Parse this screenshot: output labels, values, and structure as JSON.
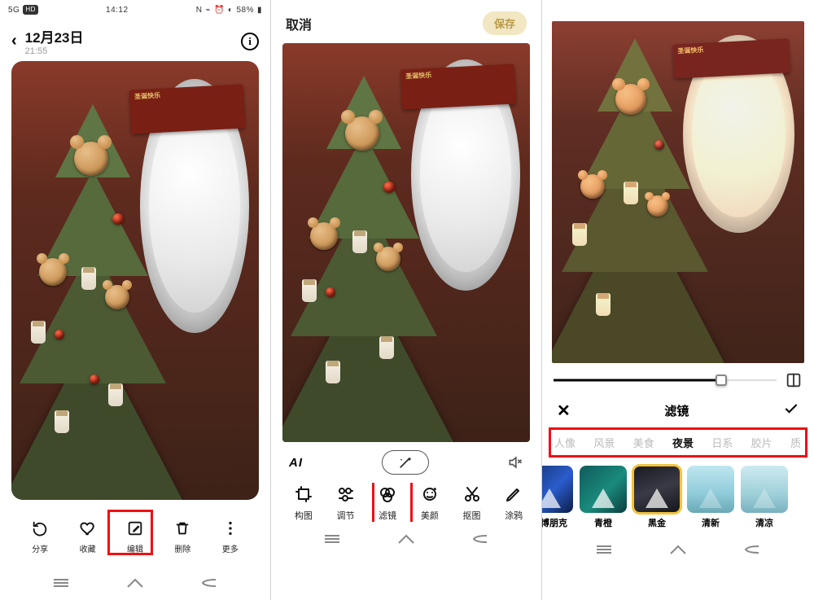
{
  "status": {
    "signal": "5G",
    "hd": "HD",
    "time": "14:12",
    "battery_pct": "58%"
  },
  "pane1": {
    "date": "12月23日",
    "time": "21:55",
    "toolbar": [
      {
        "key": "share",
        "label": "分享"
      },
      {
        "key": "fav",
        "label": "收藏"
      },
      {
        "key": "edit",
        "label": "编辑"
      },
      {
        "key": "delete",
        "label": "删除"
      },
      {
        "key": "more",
        "label": "更多"
      }
    ],
    "highlight_index": 2
  },
  "pane2": {
    "cancel": "取消",
    "save": "保存",
    "ai": "AI",
    "toolbar": [
      {
        "key": "crop",
        "label": "构图"
      },
      {
        "key": "adjust",
        "label": "调节"
      },
      {
        "key": "filter",
        "label": "滤镜"
      },
      {
        "key": "beauty",
        "label": "美颜"
      },
      {
        "key": "cutout",
        "label": "抠图"
      },
      {
        "key": "draw",
        "label": "涂鸦"
      }
    ],
    "highlight_index": 2
  },
  "pane3": {
    "slider_pct": 75,
    "header_title": "滤镜",
    "categories": [
      "人像",
      "风景",
      "美食",
      "夜景",
      "日系",
      "胶片",
      "质"
    ],
    "active_category_index": 3,
    "filters": [
      {
        "key": "cyber",
        "label": "赛博朋克",
        "swatch": "tg-cyber"
      },
      {
        "key": "qing",
        "label": "青橙",
        "swatch": "tg-qing"
      },
      {
        "key": "heijin",
        "label": "黑金",
        "swatch": "tg-hei"
      },
      {
        "key": "qingxin",
        "label": "清新",
        "swatch": "tg-qx"
      },
      {
        "key": "qingliang",
        "label": "清凉",
        "swatch": "tg-ql"
      }
    ],
    "selected_filter_index": 2
  },
  "photo": {
    "sign_text": "圣诞快乐"
  }
}
